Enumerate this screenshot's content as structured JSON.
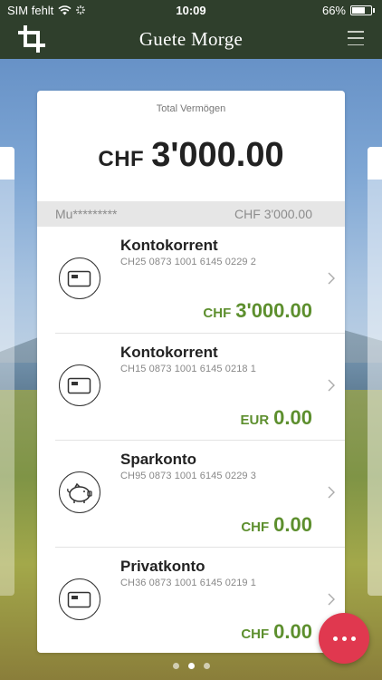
{
  "status_bar": {
    "carrier": "SIM fehlt",
    "time": "10:09",
    "battery": "66%",
    "battery_level": 0.66
  },
  "nav": {
    "title": "Guete Morge",
    "left_icon": "crop-icon",
    "right_icon": "hamburger-menu-icon"
  },
  "summary": {
    "label": "Total Vermögen",
    "currency": "CHF",
    "amount": "3'000.00"
  },
  "owner": {
    "name": "Mu*********",
    "total": "CHF 3'000.00"
  },
  "accounts": [
    {
      "name": "Kontokorrent",
      "iban": "CH25 0873 1001 6145 0229 2",
      "currency": "CHF",
      "amount": "3'000.00",
      "icon": "card-icon"
    },
    {
      "name": "Kontokorrent",
      "iban": "CH15 0873 1001 6145 0218 1",
      "currency": "EUR",
      "amount": "0.00",
      "icon": "card-icon"
    },
    {
      "name": "Sparkonto",
      "iban": "CH95 0873 1001 6145 0229 3",
      "currency": "CHF",
      "amount": "0.00",
      "icon": "piggy-bank-icon"
    },
    {
      "name": "Privatkonto",
      "iban": "CH36 0873 1001 6145 0219 1",
      "currency": "CHF",
      "amount": "0.00",
      "icon": "card-icon"
    }
  ],
  "pager": {
    "count": 3,
    "active": 1
  },
  "colors": {
    "header": "#2f3f2c",
    "balance": "#5d8f2e",
    "fab": "#e0384f"
  }
}
